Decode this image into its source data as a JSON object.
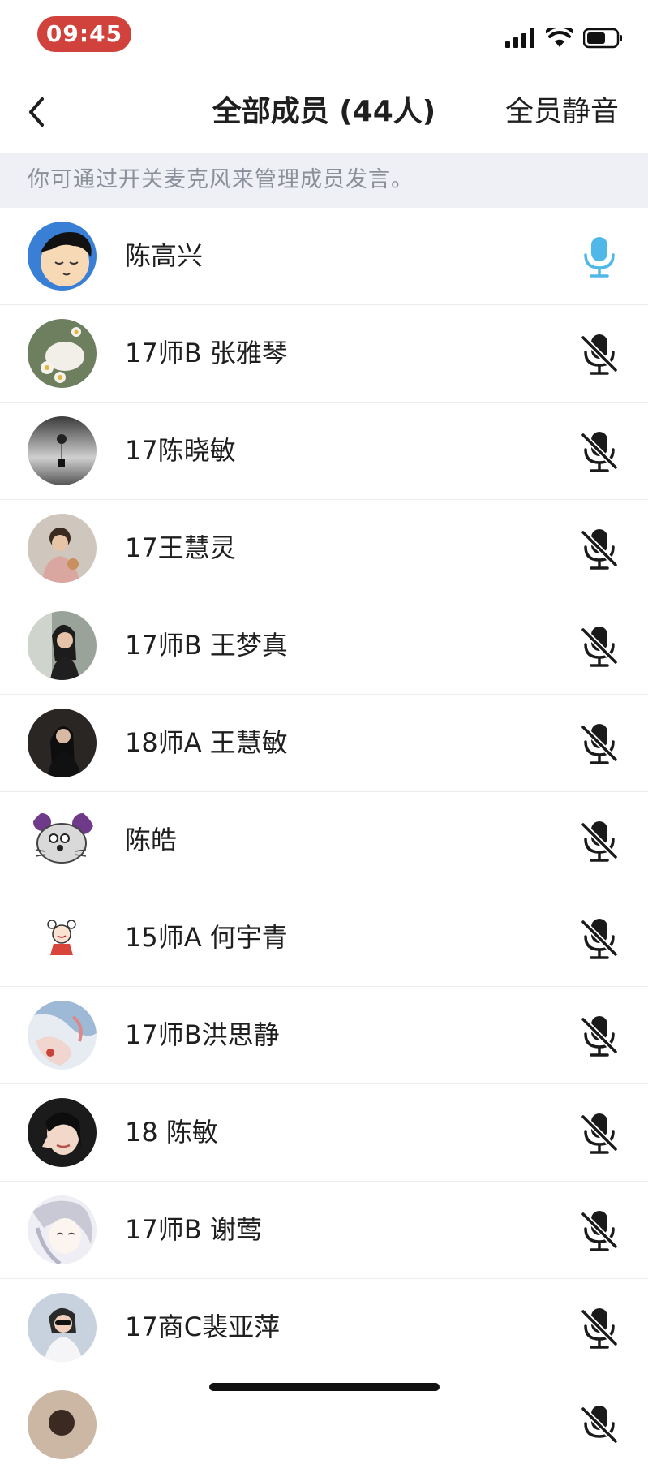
{
  "status_bar": {
    "time": "09:45"
  },
  "nav": {
    "title": "全部成员 (44人)",
    "mute_all": "全员静音"
  },
  "tip": "你可通过开关麦克风来管理成员发言。",
  "members": [
    {
      "name": "陈高兴",
      "mic": "on"
    },
    {
      "name": "17师B 张雅琴",
      "mic": "off"
    },
    {
      "name": "17陈晓敏",
      "mic": "off"
    },
    {
      "name": "17王慧灵",
      "mic": "off"
    },
    {
      "name": "17师B 王梦真",
      "mic": "off"
    },
    {
      "name": "18师A 王慧敏",
      "mic": "off"
    },
    {
      "name": "陈皓",
      "mic": "off"
    },
    {
      "name": "15师A 何宇青",
      "mic": "off"
    },
    {
      "name": "17师B洪思静",
      "mic": "off"
    },
    {
      "name": "18 陈敏",
      "mic": "off"
    },
    {
      "name": "17师B 谢莺",
      "mic": "off"
    },
    {
      "name": "17商C裴亚萍",
      "mic": "off"
    }
  ],
  "colors": {
    "mic_on": "#4fb8e8",
    "mic_off": "#1a1a1a",
    "time_pill": "#d0423b",
    "tip_bg": "#eef0f5"
  }
}
